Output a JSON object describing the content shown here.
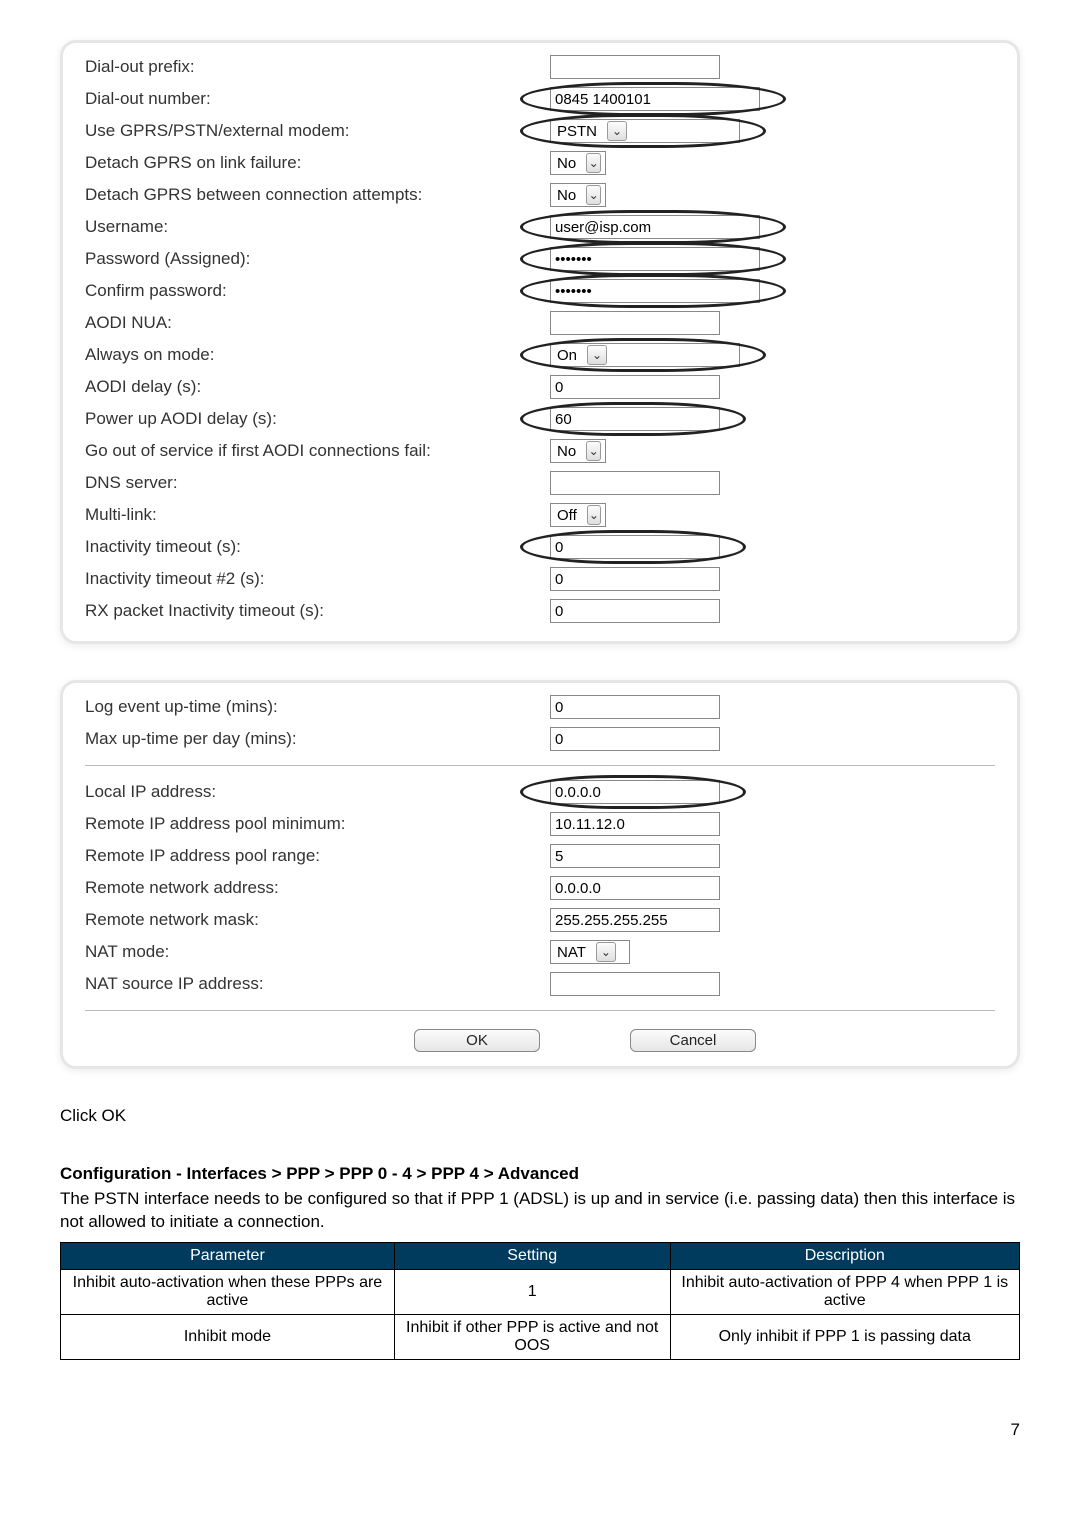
{
  "panel1": {
    "rows": [
      {
        "label": "Dial-out prefix:",
        "type": "text",
        "value": "",
        "circled": false,
        "width": "w140"
      },
      {
        "label": "Dial-out number:",
        "type": "text",
        "value": "0845 1400101",
        "circled": true,
        "width": "w200"
      },
      {
        "label": "Use GPRS/PSTN/external modem:",
        "type": "select",
        "value": "PSTN",
        "circled": true,
        "width": "w200"
      },
      {
        "label": "Detach GPRS on link failure:",
        "type": "select",
        "value": "No",
        "circled": false,
        "width": "w60"
      },
      {
        "label": "Detach GPRS between connection attempts:",
        "type": "select",
        "value": "No",
        "circled": false,
        "width": "w60"
      },
      {
        "label": "Username:",
        "type": "text",
        "value": "user@isp.com",
        "circled": true,
        "width": "w200"
      },
      {
        "label": "Password (Assigned):",
        "type": "password",
        "value": "*******",
        "circled": true,
        "width": "w200"
      },
      {
        "label": "Confirm password:",
        "type": "password",
        "value": "*******",
        "circled": true,
        "width": "w200"
      },
      {
        "label": "AODI NUA:",
        "type": "text",
        "value": "",
        "circled": false,
        "width": "w140"
      },
      {
        "label": "Always on mode:",
        "type": "select",
        "value": "On",
        "circled": true,
        "width": "w200"
      },
      {
        "label": "AODI delay (s):",
        "type": "text",
        "value": "0",
        "circled": false,
        "width": "w140"
      },
      {
        "label": "Power up AODI delay (s):",
        "type": "text",
        "value": "60",
        "circled": true,
        "width": "w140"
      },
      {
        "label": "Go out of service if first AODI connections fail:",
        "type": "select",
        "value": "No",
        "circled": false,
        "width": "w60"
      },
      {
        "label": "DNS server:",
        "type": "text",
        "value": "",
        "circled": false,
        "width": "w140"
      },
      {
        "label": "Multi-link:",
        "type": "select",
        "value": "Off",
        "circled": false,
        "width": "w60"
      },
      {
        "label": "Inactivity timeout (s):",
        "type": "text",
        "value": "0",
        "circled": true,
        "width": "w140"
      },
      {
        "label": "Inactivity timeout #2 (s):",
        "type": "text",
        "value": "0",
        "circled": false,
        "width": "w140"
      },
      {
        "label": "RX packet Inactivity timeout (s):",
        "type": "text",
        "value": "0",
        "circled": false,
        "width": "w140"
      }
    ]
  },
  "panel2": {
    "group1": [
      {
        "label": "Log event up-time (mins):",
        "type": "text",
        "value": "0",
        "circled": false,
        "width": "w140"
      },
      {
        "label": "Max up-time per day (mins):",
        "type": "text",
        "value": "0",
        "circled": false,
        "width": "w140"
      }
    ],
    "group2": [
      {
        "label": "Local IP address:",
        "type": "text",
        "value": "0.0.0.0",
        "circled": true,
        "width": "w140"
      },
      {
        "label": "Remote IP address pool minimum:",
        "type": "text",
        "value": "10.11.12.0",
        "circled": false,
        "width": "w140"
      },
      {
        "label": "Remote IP address pool range:",
        "type": "text",
        "value": "5",
        "circled": false,
        "width": "w140"
      },
      {
        "label": "Remote network address:",
        "type": "text",
        "value": "0.0.0.0",
        "circled": false,
        "width": "w140"
      },
      {
        "label": "Remote network mask:",
        "type": "text",
        "value": "255.255.255.255",
        "circled": false,
        "width": "w140"
      },
      {
        "label": "NAT mode:",
        "type": "select",
        "value": "NAT",
        "circled": false,
        "width": "w80"
      },
      {
        "label": "NAT source IP address:",
        "type": "text",
        "value": "",
        "circled": false,
        "width": "w140"
      }
    ],
    "buttons": {
      "ok": "OK",
      "cancel": "Cancel"
    }
  },
  "afterText": "Click OK",
  "sectionHeading": "Configuration - Interfaces > PPP > PPP 0 - 4 > PPP 4 > Advanced",
  "sectionBody": "The PSTN interface needs to be configured so that if PPP 1 (ADSL) is up and in service (i.e. passing data) then this interface is not allowed to initiate a connection.",
  "table": {
    "headers": [
      "Parameter",
      "Setting",
      "Description"
    ],
    "rows": [
      [
        "Inhibit auto-activation when these PPPs are active",
        "1",
        "Inhibit auto-activation of PPP 4 when PPP 1 is active"
      ],
      [
        "Inhibit mode",
        "Inhibit if other PPP is active and not OOS",
        "Only inhibit if PPP 1 is passing data"
      ]
    ]
  },
  "pageNumber": "7"
}
